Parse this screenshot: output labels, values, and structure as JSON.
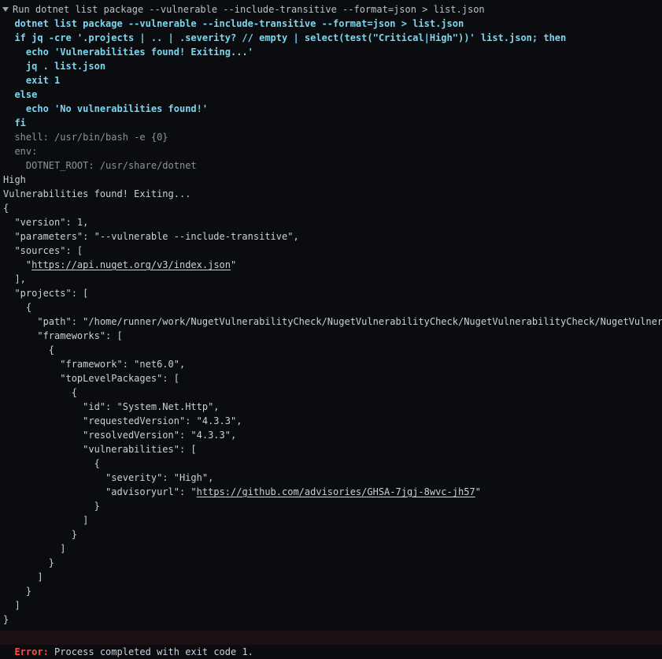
{
  "window": {
    "background_color": "#0a0c10",
    "text_color": "#c9d1d9",
    "command_color": "#79d8ef",
    "error_color": "#f85149",
    "error_bar_background": "#1d0f12"
  },
  "header": {
    "expanded": true,
    "disclosure_icon": "triangle-down-icon",
    "title": "Run dotnet list package --vulnerable --include-transitive --format=json > list.json"
  },
  "command_lines": [
    "  dotnet list package --vulnerable --include-transitive --format=json > list.json",
    "  if jq -cre '.projects | .. | .severity? // empty | select(test(\"Critical|High\"))' list.json; then",
    "    echo 'Vulnerabilities found! Exiting...'",
    "    jq . list.json",
    "    exit 1",
    "  else",
    "    echo 'No vulnerabilities found!'",
    "  fi"
  ],
  "meta_lines": [
    "  shell: /usr/bin/bash -e {0}",
    "  env:",
    "    DOTNET_ROOT: /usr/share/dotnet"
  ],
  "output_lines": [
    "High",
    "Vulnerabilities found! Exiting..."
  ],
  "json_output": [
    {
      "text": "{"
    },
    {
      "text": "  \"version\": 1,"
    },
    {
      "text": "  \"parameters\": \"--vulnerable --include-transitive\","
    },
    {
      "text": "  \"sources\": ["
    },
    {
      "prefix": "    \"",
      "link": "https://api.nuget.org/v3/index.json",
      "suffix": "\""
    },
    {
      "text": "  ],"
    },
    {
      "text": "  \"projects\": ["
    },
    {
      "text": "    {"
    },
    {
      "text": "      \"path\": \"/home/runner/work/NugetVulnerabilityCheck/NugetVulnerabilityCheck/NugetVulnerabilityCheck/NugetVulnerabilityCheck.csproj\","
    },
    {
      "text": "      \"frameworks\": ["
    },
    {
      "text": "        {"
    },
    {
      "text": "          \"framework\": \"net6.0\","
    },
    {
      "text": "          \"topLevelPackages\": ["
    },
    {
      "text": "            {"
    },
    {
      "text": "              \"id\": \"System.Net.Http\","
    },
    {
      "text": "              \"requestedVersion\": \"4.3.3\","
    },
    {
      "text": "              \"resolvedVersion\": \"4.3.3\","
    },
    {
      "text": "              \"vulnerabilities\": ["
    },
    {
      "text": "                {"
    },
    {
      "text": "                  \"severity\": \"High\","
    },
    {
      "prefix": "                  \"advisoryurl\": \"",
      "link": "https://github.com/advisories/GHSA-7jgj-8wvc-jh57",
      "suffix": "\""
    },
    {
      "text": "                }"
    },
    {
      "text": "              ]"
    },
    {
      "text": "            }"
    },
    {
      "text": "          ]"
    },
    {
      "text": "        }"
    },
    {
      "text": "      ]"
    },
    {
      "text": "    }"
    },
    {
      "text": "  ]"
    },
    {
      "text": "}"
    }
  ],
  "footer": {
    "error_label": "Error:",
    "error_message": " Process completed with exit code 1."
  }
}
